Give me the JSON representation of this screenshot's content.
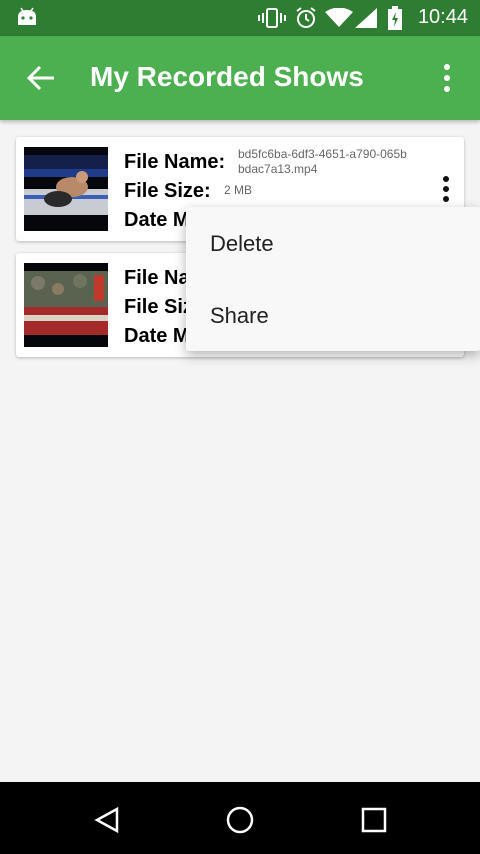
{
  "status_bar": {
    "time": "10:44",
    "icons": [
      "android-icon",
      "vibrate-icon",
      "alarm-icon",
      "wifi-icon",
      "signal-icon",
      "battery-icon"
    ]
  },
  "app_bar": {
    "title": "My Recorded Shows",
    "back_icon": "arrow-back-icon",
    "overflow_icon": "more-vert-icon",
    "color": "#4caf50",
    "status_color": "#2f7d32"
  },
  "recordings": [
    {
      "file_name_label": "File Name:",
      "file_name": "bd5fc6ba-6df3-4651-a790-065bbdac7a13.mp4",
      "file_size_label": "File Size:",
      "file_size": "2 MB",
      "date_label": "Date M",
      "thumbnail": "wrestling-match-thumbnail"
    },
    {
      "file_name_label": "File Na",
      "file_size_label": "File Siz",
      "date_label": "Date M",
      "thumbnail": "wrestling-crowd-thumbnail"
    }
  ],
  "context_menu": {
    "items": [
      "Delete",
      "Share"
    ]
  },
  "nav_bar": {
    "icons": [
      "back-triangle-icon",
      "home-circle-icon",
      "recents-square-icon"
    ]
  }
}
